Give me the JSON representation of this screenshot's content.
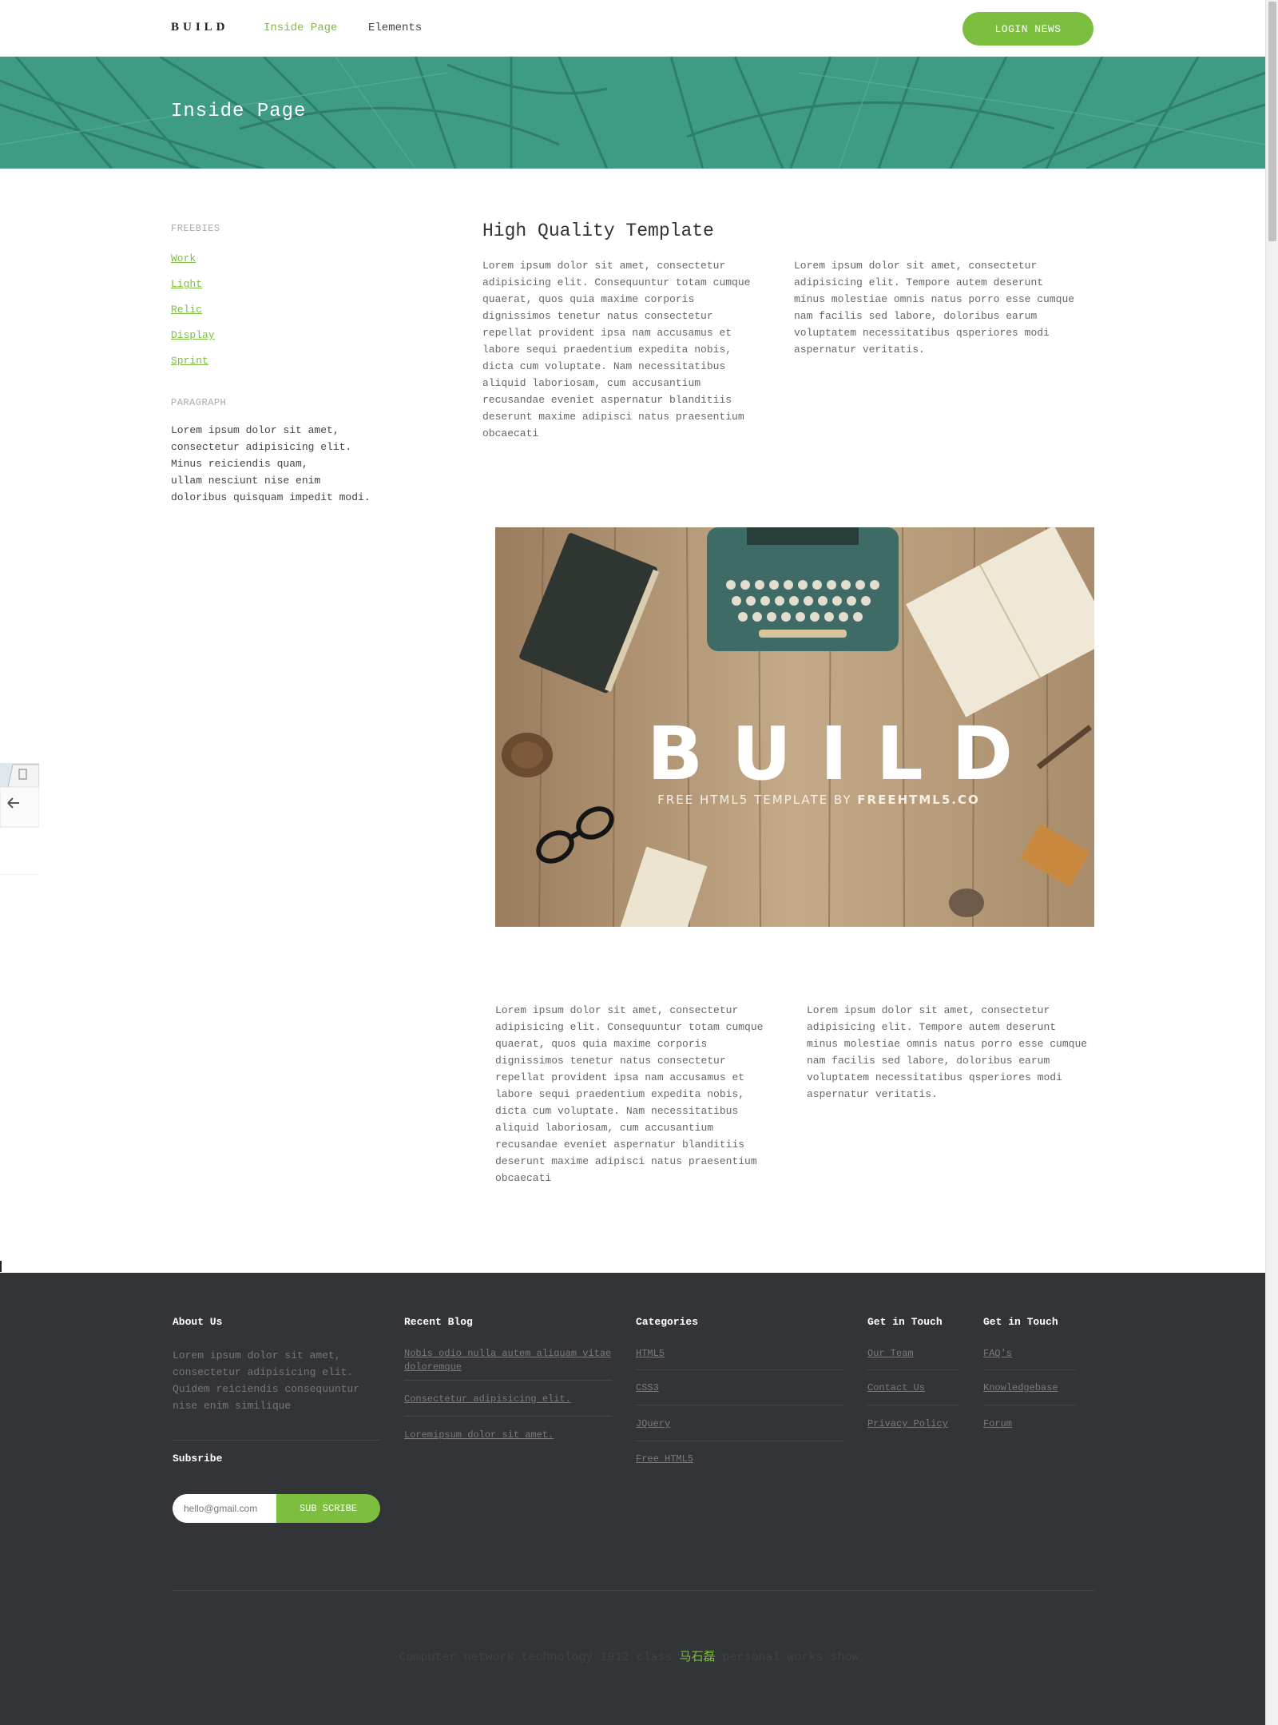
{
  "header": {
    "logo": "BUILD",
    "nav": [
      "Inside Page",
      "Elements"
    ],
    "login_button": "LOGIN NEWS"
  },
  "hero": {
    "title": "Inside Page"
  },
  "sidebar": {
    "freebies_heading": "FREEBIES",
    "links": [
      "Work",
      "Light",
      "Relic",
      "Display",
      "Sprint"
    ],
    "paragraph_heading": "PARAGRAPH",
    "paragraph_lines": [
      "Lorem ipsum dolor sit amet,",
      "consectetur adipisicing elit.",
      "Minus reiciendis quam,",
      "ullam nesciunt nise enim",
      "doloribus quisquam impedit modi."
    ]
  },
  "main": {
    "title": "High Quality Template",
    "para_long_lines": [
      "Lorem ipsum dolor sit amet, consectetur",
      "adipisicing elit. Consequuntur totam cumque",
      "quaerat, quos quia maxime corporis",
      "dignissimos tenetur natus consectetur",
      "repellat provident ipsa nam accusamus et",
      "labore sequi praedentium expedita nobis,",
      "dicta cum voluptate. Nam necessitatibus",
      "aliquid laboriosam, cum accusantium",
      "recusandae eveniet aspernatur blanditiis",
      "deserunt maxime adipisci natus praesentium",
      "obcaecati"
    ],
    "para_short_lines": [
      "Lorem ipsum dolor sit amet, consectetur",
      "adipisicing elit. Tempore autem deserunt",
      "minus molestiae omnis natus porro esse cumque",
      "nam facilis sed labore, doloribus earum",
      "voluptatem necessitatibus qsperiores modi",
      "aspernatur veritatis."
    ],
    "image": {
      "title": "BUILD",
      "subtitle_plain": "FREE HTML5 TEMPLATE BY ",
      "subtitle_bold": "FREEHTML5.CO"
    }
  },
  "footer": {
    "about": {
      "heading": "About Us",
      "lines": [
        "Lorem ipsum dolor sit amet,",
        "consectetur adipisicing elit.",
        "Quidem reiciendis consequuntur",
        "nise enim similique"
      ]
    },
    "subscribe": {
      "heading": "Subsribe",
      "placeholder": "hello@gmail.com",
      "button": "SUB SCRIBE"
    },
    "recent_blog": {
      "heading": "Recent Blog",
      "links": [
        "Nobis odio nulla autem aliquam vitae doloremque",
        "Consectetur adipisicing elit.",
        "Loremipsum dolor sit amet."
      ]
    },
    "categories": {
      "heading": "Categories",
      "links": [
        "HTML5",
        "CSS3",
        "JQuery",
        "Free HTML5"
      ]
    },
    "get_in_touch_1": {
      "heading": "Get in Touch",
      "links": [
        "Our Team",
        "Contact Us",
        "Privacy Policy"
      ]
    },
    "get_in_touch_2": {
      "heading": "Get in Touch",
      "links": [
        "FAQ's",
        "Knowledgebase",
        "Forum"
      ]
    },
    "copyright_before": "Computer network technology 1912 class ",
    "copyright_name": "马石磊",
    "copyright_after": " personal works show."
  },
  "colors": {
    "accent": "#7cbf3f",
    "hero": "#3e9c84",
    "footer_bg": "#323438"
  }
}
